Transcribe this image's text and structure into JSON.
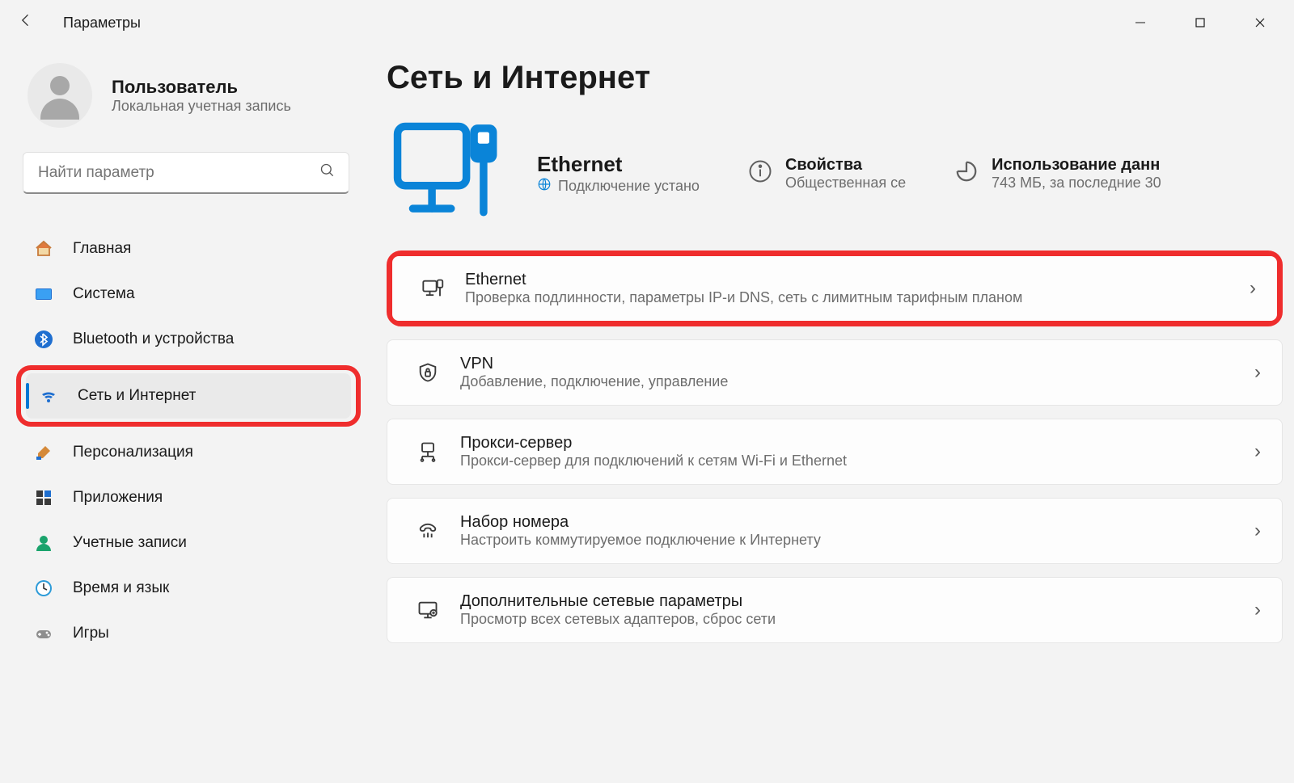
{
  "window": {
    "title": "Параметры"
  },
  "account": {
    "name": "Пользователь",
    "subtitle": "Локальная учетная запись"
  },
  "search": {
    "placeholder": "Найти параметр"
  },
  "sidebar": {
    "items": [
      {
        "label": "Главная"
      },
      {
        "label": "Система"
      },
      {
        "label": "Bluetooth и устройства"
      },
      {
        "label": "Сеть и Интернет"
      },
      {
        "label": "Персонализация"
      },
      {
        "label": "Приложения"
      },
      {
        "label": "Учетные записи"
      },
      {
        "label": "Время и язык"
      },
      {
        "label": "Игры"
      }
    ]
  },
  "page": {
    "heading": "Сеть и Интернет",
    "hero": {
      "title": "Ethernet",
      "status": "Подключение устано",
      "prop_title": "Свойства",
      "prop_sub": "Общественная се",
      "usage_title": "Использование данн",
      "usage_sub": "743 МБ, за последние 30"
    },
    "cards": [
      {
        "title": "Ethernet",
        "sub": "Проверка подлинности, параметры IP-и DNS, сеть с лимитным тарифным планом"
      },
      {
        "title": "VPN",
        "sub": "Добавление, подключение, управление"
      },
      {
        "title": "Прокси-сервер",
        "sub": "Прокси-сервер для подключений к сетям Wi-Fi и Ethernet"
      },
      {
        "title": "Набор номера",
        "sub": "Настроить коммутируемое подключение к Интернету"
      },
      {
        "title": "Дополнительные сетевые параметры",
        "sub": "Просмотр всех сетевых адаптеров, сброс сети"
      }
    ]
  }
}
